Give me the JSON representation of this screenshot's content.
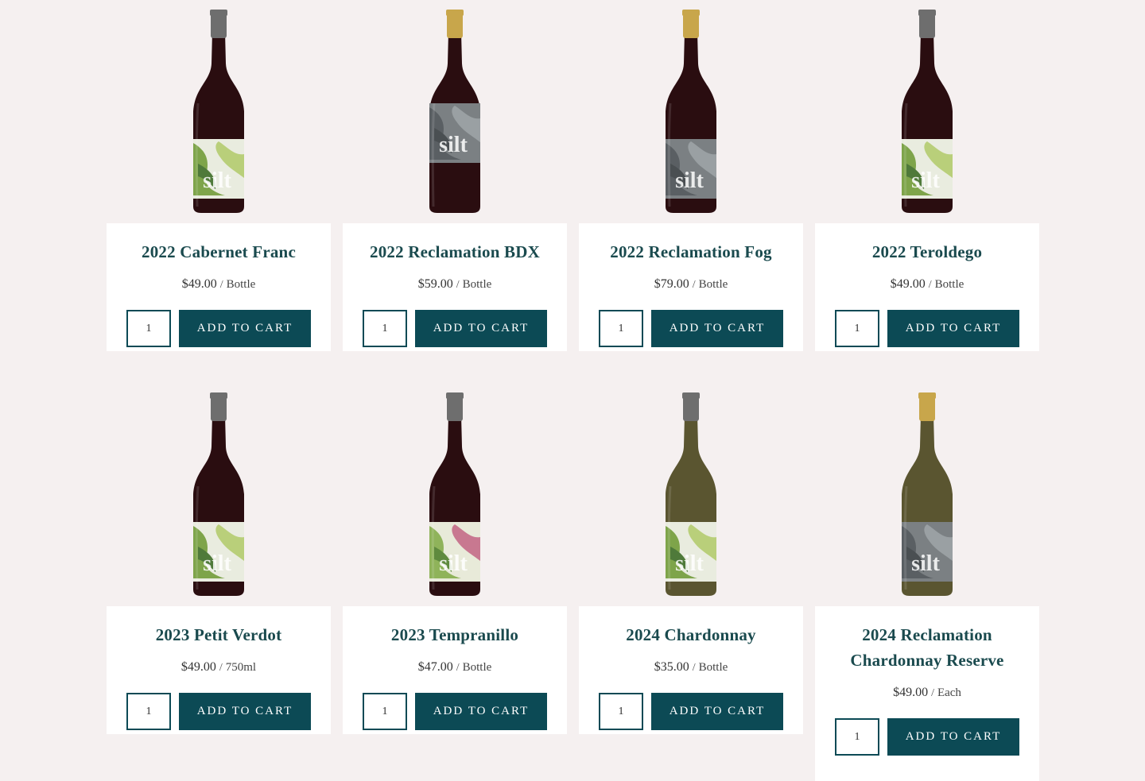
{
  "products": [
    {
      "name": "2022 Cabernet Franc",
      "price": "$49.00",
      "unit": "Bottle",
      "qty": "1",
      "cta": "ADD TO CART",
      "wine": "red",
      "capsule": "#6e6e6e",
      "label": "green-marble",
      "label_text": "silt"
    },
    {
      "name": "2022 Reclamation BDX",
      "price": "$59.00",
      "unit": "Bottle",
      "qty": "1",
      "cta": "ADD TO CART",
      "wine": "red",
      "capsule": "#c8a64b",
      "label": "gray-marble",
      "label_text": "silt"
    },
    {
      "name": "2022 Reclamation Fog",
      "price": "$79.00",
      "unit": "Bottle",
      "qty": "1",
      "cta": "ADD TO CART",
      "wine": "red",
      "capsule": "#c8a64b",
      "label": "gray-marble",
      "label_text": "silt"
    },
    {
      "name": "2022 Teroldego",
      "price": "$49.00",
      "unit": "Bottle",
      "qty": "1",
      "cta": "ADD TO CART",
      "wine": "red",
      "capsule": "#6e6e6e",
      "label": "green-marble",
      "label_text": "silt"
    },
    {
      "name": "2023 Petit Verdot",
      "price": "$49.00",
      "unit": "750ml",
      "qty": "1",
      "cta": "ADD TO CART",
      "wine": "red",
      "capsule": "#6e6e6e",
      "label": "green-marble",
      "label_text": "silt"
    },
    {
      "name": "2023 Tempranillo",
      "price": "$47.00",
      "unit": "Bottle",
      "qty": "1",
      "cta": "ADD TO CART",
      "wine": "red",
      "capsule": "#6e6e6e",
      "label": "green-pink-marble",
      "label_text": "silt"
    },
    {
      "name": "2024 Chardonnay",
      "price": "$35.00",
      "unit": "Bottle",
      "qty": "1",
      "cta": "ADD TO CART",
      "wine": "white",
      "capsule": "#6e6e6e",
      "label": "green-marble",
      "label_text": "silt"
    },
    {
      "name": "2024 Reclamation Chardonnay Reserve",
      "price": "$49.00",
      "unit": "Each",
      "qty": "1",
      "cta": "ADD TO CART",
      "wine": "white",
      "capsule": "#c8a64b",
      "label": "gray-marble",
      "label_text": "silt"
    }
  ],
  "separator": "/",
  "colors": {
    "background": "#f5f0f0",
    "card": "#ffffff",
    "accent": "#0c4a55",
    "title": "#1a4a4e",
    "red_bottle": "#2a0d10",
    "white_bottle": "#5a5530"
  }
}
